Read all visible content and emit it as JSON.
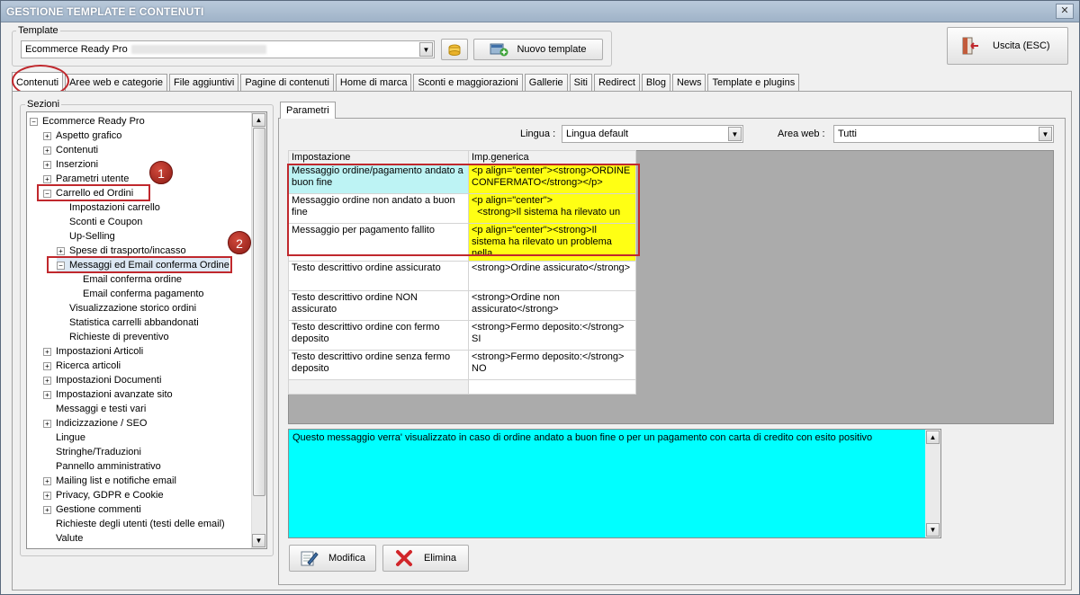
{
  "window": {
    "title": "GESTIONE TEMPLATE E CONTENUTI",
    "close_label": "✕"
  },
  "template_group": {
    "label": "Template",
    "select_value": "Ecommerce Ready Pro",
    "new_template_label": "Nuovo template"
  },
  "exit_button": {
    "label": "Uscita (ESC)"
  },
  "tabs": [
    {
      "label": "Contenuti",
      "active": true
    },
    {
      "label": "Aree web e categorie"
    },
    {
      "label": "File aggiuntivi"
    },
    {
      "label": "Pagine di contenuti"
    },
    {
      "label": "Home di marca"
    },
    {
      "label": "Sconti e maggiorazioni"
    },
    {
      "label": "Gallerie"
    },
    {
      "label": "Siti"
    },
    {
      "label": "Redirect"
    },
    {
      "label": "Blog"
    },
    {
      "label": "News"
    },
    {
      "label": "Template e plugins"
    }
  ],
  "sections": {
    "label": "Sezioni",
    "tree": [
      {
        "label": "Ecommerce Ready Pro",
        "expander": "−"
      },
      {
        "label": "Aspetto grafico",
        "expander": "+"
      },
      {
        "label": "Contenuti",
        "expander": "+"
      },
      {
        "label": "Inserzioni",
        "expander": "+"
      },
      {
        "label": "Parametri utente",
        "expander": "+"
      },
      {
        "label": "Carrello ed Ordini",
        "expander": "−"
      },
      {
        "label": "Impostazioni carrello",
        "expander": ""
      },
      {
        "label": "Sconti e Coupon",
        "expander": ""
      },
      {
        "label": "Up-Selling",
        "expander": ""
      },
      {
        "label": "Spese di trasporto/incasso",
        "expander": "+"
      },
      {
        "label": "Messaggi ed Email conferma Ordine",
        "expander": "−"
      },
      {
        "label": "Email conferma ordine",
        "expander": ""
      },
      {
        "label": "Email conferma pagamento",
        "expander": ""
      },
      {
        "label": "Visualizzazione storico ordini",
        "expander": ""
      },
      {
        "label": "Statistica carrelli abbandonati",
        "expander": ""
      },
      {
        "label": "Richieste di preventivo",
        "expander": ""
      },
      {
        "label": "Impostazioni Articoli",
        "expander": "+"
      },
      {
        "label": "Ricerca articoli",
        "expander": "+"
      },
      {
        "label": "Impostazioni Documenti",
        "expander": "+"
      },
      {
        "label": "Impostazioni avanzate sito",
        "expander": "+"
      },
      {
        "label": "Messaggi e testi vari",
        "expander": ""
      },
      {
        "label": "Indicizzazione / SEO",
        "expander": "+"
      },
      {
        "label": "Lingue",
        "expander": ""
      },
      {
        "label": "Stringhe/Traduzioni",
        "expander": ""
      },
      {
        "label": "Pannello amministrativo",
        "expander": ""
      },
      {
        "label": "Mailing list e notifiche email",
        "expander": "+"
      },
      {
        "label": "Privacy, GDPR e Cookie",
        "expander": "+"
      },
      {
        "label": "Gestione commenti",
        "expander": "+"
      },
      {
        "label": "Richieste degli utenti (testi delle email)",
        "expander": ""
      },
      {
        "label": "Valute",
        "expander": ""
      }
    ]
  },
  "badges": [
    "1",
    "2"
  ],
  "params": {
    "tab_label": "Parametri",
    "lingua_label": "Lingua :",
    "lingua_value": "Lingua default",
    "area_label": "Area web :",
    "area_value": "Tutti",
    "col_setting": "Impostazione",
    "col_value": "Imp.generica",
    "rows": [
      {
        "setting": "Messaggio ordine/pagamento andato a buon fine",
        "value": "<p align=\"center\"><strong>ORDINE CONFERMATO</strong></p>"
      },
      {
        "setting": "Messaggio ordine non andato a buon fine",
        "value": "<p align=\"center\">\n  <strong>Il sistema ha rilevato un"
      },
      {
        "setting": "Messaggio per pagamento fallito",
        "value": "<p align=\"center\"><strong>Il sistema ha rilevato un problema nella"
      },
      {
        "setting": "Testo descrittivo ordine assicurato",
        "value": "<strong>Ordine assicurato</strong>"
      },
      {
        "setting": "Testo descrittivo ordine NON assicurato",
        "value": "<strong>Ordine non assicurato</strong>"
      },
      {
        "setting": "Testo descrittivo ordine con fermo deposito",
        "value": "<strong>Fermo deposito:</strong> SI"
      },
      {
        "setting": "Testo descrittivo ordine senza fermo deposito",
        "value": "<strong>Fermo deposito:</strong> NO"
      }
    ],
    "description": "Questo messaggio verra' visualizzato in caso di ordine andato a buon fine o per un pagamento con carta di credito con esito positivo"
  },
  "actions": {
    "edit_label": "Modifica",
    "delete_label": "Elimina"
  },
  "colors": {
    "accent_red": "#c0282d",
    "selected_cyan": "#bdf3f4",
    "highlight_yellow": "#ffff14",
    "desc_cyan": "#00ffff"
  }
}
